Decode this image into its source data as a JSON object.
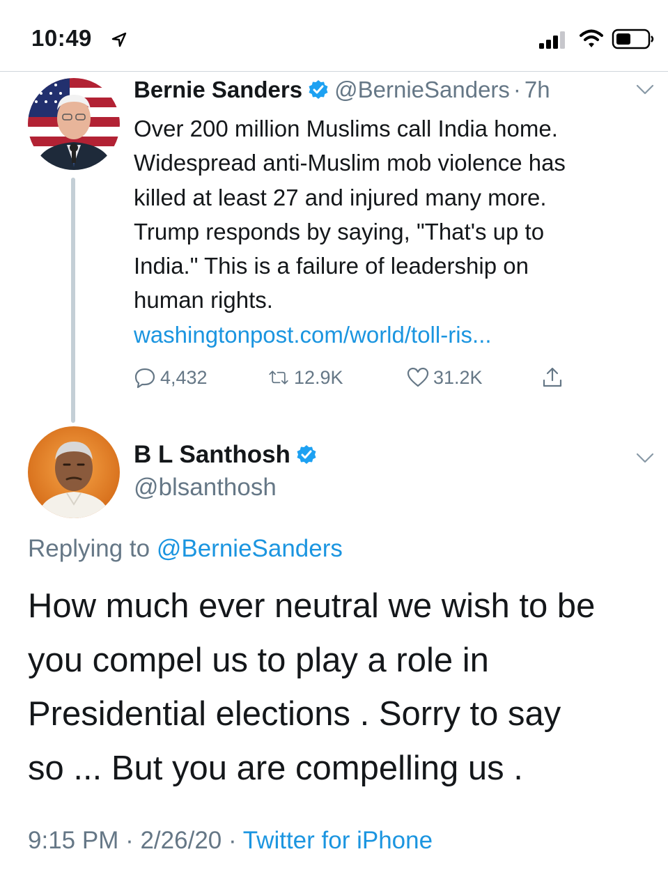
{
  "status_bar": {
    "time": "10:49",
    "icons": [
      "location-arrow-icon",
      "cellular-signal-icon",
      "wifi-icon",
      "battery-icon"
    ]
  },
  "tweet1": {
    "name": "Bernie Sanders",
    "handle": "@BernieSanders",
    "separator": "·",
    "age": "7h",
    "text_lines": [
      "Over 200 million Muslims call India home.",
      "Widespread anti-Muslim mob violence has",
      "killed at least 27 and injured many more.",
      "Trump responds by saying, \"That's up to",
      "India.\" This is a failure of leadership on",
      "human rights."
    ],
    "link": "washingtonpost.com/world/toll-ris...",
    "replies": "4,432",
    "retweets": "12.9K",
    "likes": "31.2K"
  },
  "tweet2": {
    "name": "B L Santhosh",
    "handle": "@blsanthosh",
    "replying_prefix": "Replying to ",
    "replying_to": "@BernieSanders",
    "text_lines": [
      "How much ever neutral we wish to be",
      "you compel us to play a role in",
      "Presidential elections . Sorry to say",
      "so ... But you are compelling us ."
    ],
    "time": "9:15 PM",
    "date": "2/26/20",
    "meta_sep": " · ",
    "source": "Twitter for iPhone"
  },
  "colors": {
    "link_blue": "#1b95e0",
    "secondary_text": "#657786",
    "primary_text": "#14171a",
    "thread_line": "#c4cfd6"
  }
}
